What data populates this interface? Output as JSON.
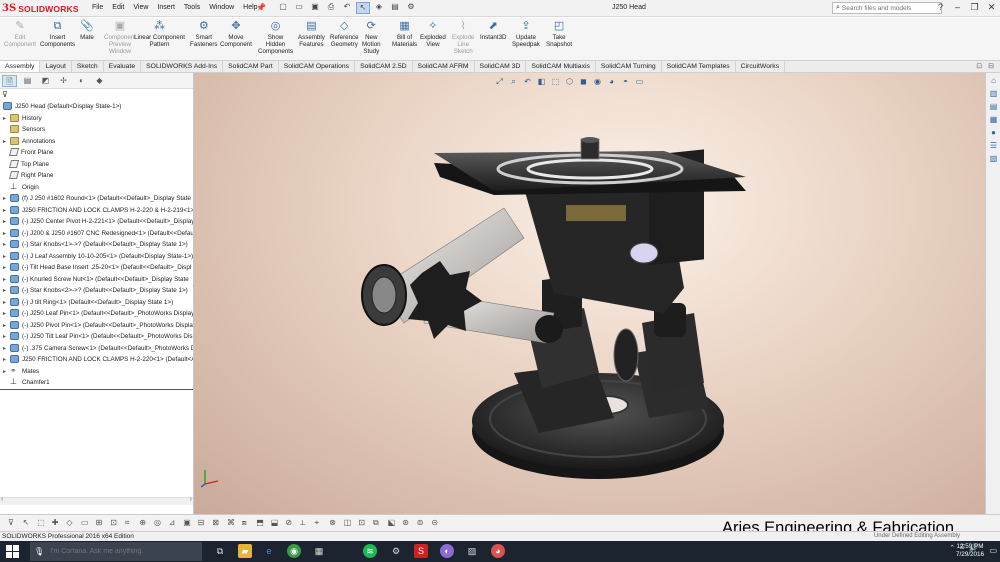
{
  "app": {
    "logo_ds": "3S",
    "logo_text": "SOLIDWORKS",
    "document_title": "J250 Head"
  },
  "menus": [
    "File",
    "Edit",
    "View",
    "Insert",
    "Tools",
    "Window",
    "Help"
  ],
  "search": {
    "placeholder": "Search files and models"
  },
  "ribbon": [
    {
      "label": "Edit\nComponent",
      "icon": "edit-component-icon",
      "glyph": "✎",
      "enabled": false
    },
    {
      "label": "Insert\nComponents",
      "icon": "insert-components-icon",
      "glyph": "⧉",
      "enabled": true
    },
    {
      "label": "Mate",
      "icon": "mate-icon",
      "glyph": "📎",
      "enabled": true
    },
    {
      "label": "Component\nPreview\nWindow",
      "icon": "preview-window-icon",
      "glyph": "▣",
      "enabled": false
    },
    {
      "label": "Linear Component\nPattern",
      "icon": "linear-pattern-icon",
      "glyph": "⁂",
      "enabled": true
    },
    {
      "label": "Smart\nFasteners",
      "icon": "smart-fasteners-icon",
      "glyph": "⚙",
      "enabled": true
    },
    {
      "label": "Move\nComponent",
      "icon": "move-component-icon",
      "glyph": "✥",
      "enabled": true
    },
    {
      "label": "Show\nHidden\nComponents",
      "icon": "show-hidden-icon",
      "glyph": "◎",
      "enabled": true
    },
    {
      "label": "Assembly\nFeatures",
      "icon": "assembly-features-icon",
      "glyph": "▤",
      "enabled": true
    },
    {
      "label": "Reference\nGeometry",
      "icon": "reference-geometry-icon",
      "glyph": "◇",
      "enabled": true
    },
    {
      "label": "New\nMotion\nStudy",
      "icon": "motion-study-icon",
      "glyph": "⟳",
      "enabled": true
    },
    {
      "label": "Bill of\nMaterials",
      "icon": "bom-icon",
      "glyph": "▦",
      "enabled": true
    },
    {
      "label": "Exploded\nView",
      "icon": "exploded-view-icon",
      "glyph": "✧",
      "enabled": true
    },
    {
      "label": "Explode\nLine\nSketch",
      "icon": "explode-line-icon",
      "glyph": "⌇",
      "enabled": false
    },
    {
      "label": "Instant3D",
      "icon": "instant3d-icon",
      "glyph": "⬈",
      "enabled": true
    },
    {
      "label": "Update\nSpeedpak",
      "icon": "speedpak-icon",
      "glyph": "⇪",
      "enabled": true
    },
    {
      "label": "Take\nSnapshot",
      "icon": "snapshot-icon",
      "glyph": "◰",
      "enabled": true
    }
  ],
  "tabs": [
    "Assembly",
    "Layout",
    "Sketch",
    "Evaluate",
    "SOLIDWORKS Add-Ins",
    "SolidCAM Part",
    "SolidCAM Operations",
    "SolidCAM 2.5D",
    "SolidCAM AFRM",
    "SolidCAM 3D",
    "SolidCAM Multiaxis",
    "SolidCAM Turning",
    "SolidCAM Templates",
    "CircuitWorks"
  ],
  "active_tab": "Assembly",
  "tree": {
    "root": "J250 Head  (Default<Display State-1>)",
    "items": [
      {
        "label": "History",
        "icon": "fold",
        "exp": true
      },
      {
        "label": "Sensors",
        "icon": "fold",
        "exp": false
      },
      {
        "label": "Annotations",
        "icon": "fold",
        "exp": true
      },
      {
        "label": "Front Plane",
        "icon": "plane",
        "exp": false
      },
      {
        "label": "Top Plane",
        "icon": "plane",
        "exp": false
      },
      {
        "label": "Right Plane",
        "icon": "plane",
        "exp": false
      },
      {
        "label": "Origin",
        "icon": "origin",
        "exp": false
      },
      {
        "label": "(f) J 250 #1602 Round<1> (Default<<Default>_Display State 1",
        "icon": "asm",
        "exp": true
      },
      {
        "label": "J250 FRICTION AND LOCK CLAMPS H-2-220 & H-2-219<1> (",
        "icon": "asm",
        "exp": true
      },
      {
        "label": "(-) J250 Center Pivot H-2-221<1> (Default<<Default>_Display",
        "icon": "asm",
        "exp": true
      },
      {
        "label": "(-) J200 & J250 #1607 CNC Redesigned<1> (Default<<Default",
        "icon": "asm",
        "exp": true
      },
      {
        "label": "(-) Star Knobs<1>->? (Default<<Default>_Display State 1>)",
        "icon": "asm",
        "exp": true
      },
      {
        "label": "(-) J Leaf Assembly 10-10-205<1> (Default<Display State-1>)",
        "icon": "asm",
        "exp": true
      },
      {
        "label": "(-) Tilt Head Base Insert .25-20<1> (Default<<Default>_Displ",
        "icon": "asm",
        "exp": true
      },
      {
        "label": "(-) Knurled Screw Nut<1> (Default<<Default>_Display State",
        "icon": "asm",
        "exp": true
      },
      {
        "label": "(-) Star Knobs<2>->? (Default<<Default>_Display State 1>)",
        "icon": "asm",
        "exp": true
      },
      {
        "label": "(-) J tilt Ring<1> (Default<<Default>_Display State 1>)",
        "icon": "asm",
        "exp": true
      },
      {
        "label": "(-) J250 Leaf Pin<1> (Default<<Default>_PhotoWorks Display",
        "icon": "asm",
        "exp": true
      },
      {
        "label": "(-) J250 Pivot Pin<1> (Default<<Default>_PhotoWorks Displa",
        "icon": "asm",
        "exp": true
      },
      {
        "label": "(-) J250 Tilt Leaf Pin<1> (Default<<Default>_PhotoWorks Dis",
        "icon": "asm",
        "exp": true
      },
      {
        "label": "(-) .375 Camera Screw<1> (Default<<Default>_PhotoWorks D",
        "icon": "asm",
        "exp": true
      },
      {
        "label": "J250 FRICTION AND LOCK CLAMPS H-2-220<1> (Default<As",
        "icon": "asm",
        "exp": true
      },
      {
        "label": "Mates",
        "icon": "mate",
        "exp": true
      },
      {
        "label": "Chamfer1",
        "icon": "origin",
        "exp": false
      }
    ]
  },
  "watermark": "Aries Engineering & Fabrication",
  "status": {
    "left": "SOLIDWORKS Professional 2016 x64 Edition",
    "right": "Under Defined   Editing Assembly"
  },
  "taskbar": {
    "cortana_placeholder": "I'm Cortana. Ask me anything.",
    "time": "12:59 PM",
    "date": "7/29/2016"
  },
  "colors": {
    "brand_red": "#d71920",
    "selection_blue": "#1e5aa8",
    "model_dark": "#2b2b2b",
    "taskbar": "#1c2430"
  }
}
